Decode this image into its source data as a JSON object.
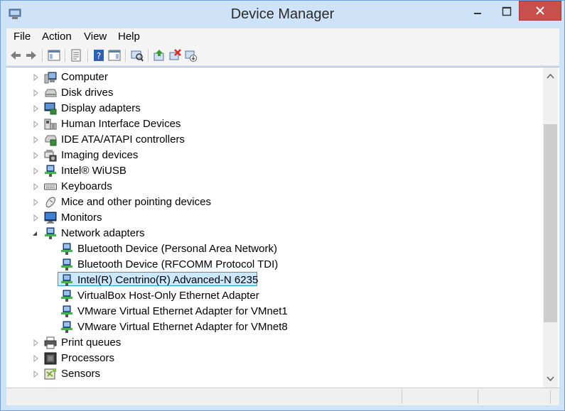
{
  "window": {
    "title": "Device Manager"
  },
  "menu": [
    "File",
    "Action",
    "View",
    "Help"
  ],
  "toolbar_icons": [
    "back-icon",
    "forward-icon",
    "show-hide-console-tree-icon",
    "properties-icon",
    "help-icon",
    "show-action-pane-icon",
    "scan-hardware-icon",
    "update-driver-icon",
    "uninstall-icon",
    "disable-device-icon"
  ],
  "tree": {
    "categories_top": [
      {
        "label": "Computer",
        "icon": "computer-icon"
      },
      {
        "label": "Disk drives",
        "icon": "disk-drive-icon"
      },
      {
        "label": "Display adapters",
        "icon": "display-adapter-icon"
      },
      {
        "label": "Human Interface Devices",
        "icon": "hid-icon"
      },
      {
        "label": "IDE ATA/ATAPI controllers",
        "icon": "ide-controller-icon"
      },
      {
        "label": "Imaging devices",
        "icon": "camera-icon"
      },
      {
        "label": "Intel® WiUSB",
        "icon": "network-icon"
      },
      {
        "label": "Keyboards",
        "icon": "keyboard-icon"
      },
      {
        "label": "Mice and other pointing devices",
        "icon": "mouse-icon"
      },
      {
        "label": "Monitors",
        "icon": "monitor-icon"
      }
    ],
    "network": {
      "label": "Network adapters",
      "children": [
        "Bluetooth Device (Personal Area Network)",
        "Bluetooth Device (RFCOMM Protocol TDI)",
        "Intel(R) Centrino(R) Advanced-N 6235",
        "VirtualBox Host-Only Ethernet Adapter",
        "VMware Virtual Ethernet Adapter for VMnet1",
        "VMware Virtual Ethernet Adapter for VMnet8"
      ],
      "selected_child": "Intel(R) Centrino(R) Advanced-N 6235"
    },
    "categories_bottom": [
      {
        "label": "Print queues",
        "icon": "printer-icon"
      },
      {
        "label": "Processors",
        "icon": "processor-icon"
      },
      {
        "label": "Sensors",
        "icon": "sensor-icon"
      }
    ]
  },
  "colors": {
    "selection": "#cce8ff",
    "selection_border": "#26a0da",
    "close": "#c7504c",
    "frame": "#cfe3f8"
  }
}
